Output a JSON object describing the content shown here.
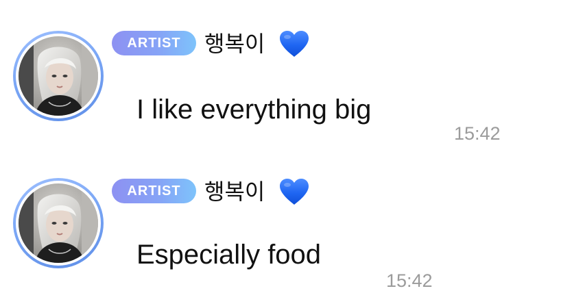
{
  "messages": [
    {
      "badge": "ARTIST",
      "sender": "행복이",
      "heart_icon": "blue-heart-emoji",
      "text": "I like everything big",
      "time": "15:42"
    },
    {
      "badge": "ARTIST",
      "sender": "행복이",
      "heart_icon": "blue-heart-emoji",
      "text": "Especially food",
      "time": "15:42"
    }
  ],
  "colors": {
    "badge_gradient_start": "#8d91f2",
    "badge_gradient_end": "#7ec3fb",
    "avatar_ring": "#7aa6f5",
    "heart": "#1f66f2",
    "time_text": "#9b9b9b",
    "message_text": "#111111"
  }
}
